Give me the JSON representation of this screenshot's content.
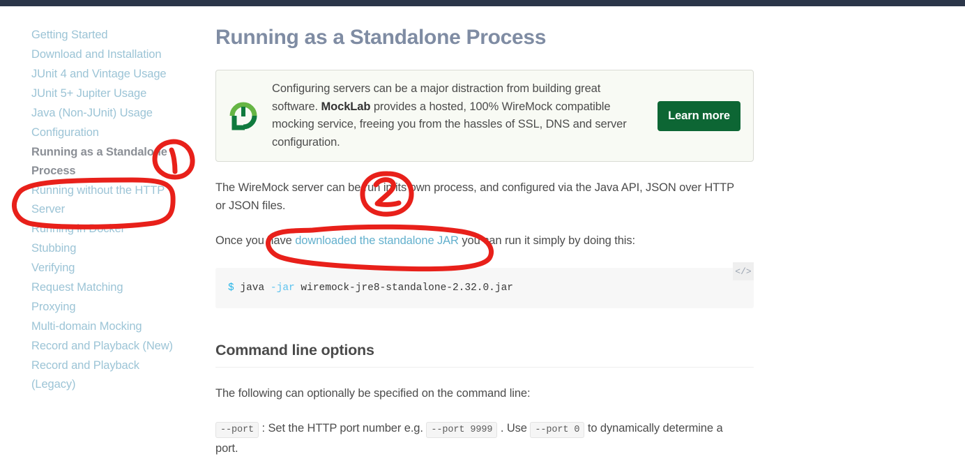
{
  "topbar": {
    "color": "#2b3649"
  },
  "sidebar": {
    "items": [
      {
        "label": "Getting Started",
        "active": false
      },
      {
        "label": "Download and Installation",
        "active": false
      },
      {
        "label": "JUnit 4 and Vintage Usage",
        "active": false
      },
      {
        "label": "JUnit 5+ Jupiter Usage",
        "active": false
      },
      {
        "label": "Java (Non-JUnit) Usage",
        "active": false
      },
      {
        "label": "Configuration",
        "active": false
      },
      {
        "label": "Running as a Standalone Process",
        "active": true
      },
      {
        "label": "Running without the HTTP Server",
        "active": false
      },
      {
        "label": "Running in Docker",
        "active": false
      },
      {
        "label": "Stubbing",
        "active": false
      },
      {
        "label": "Verifying",
        "active": false
      },
      {
        "label": "Request Matching",
        "active": false
      },
      {
        "label": "Proxying",
        "active": false
      },
      {
        "label": "Multi-domain Mocking",
        "active": false
      },
      {
        "label": "Record and Playback (New)",
        "active": false
      },
      {
        "label": "Record and Playback (Legacy)",
        "active": false
      }
    ],
    "link_color": "#9cc4d6",
    "active_color": "#8b8f96"
  },
  "main": {
    "title": "Running as a Standalone Process",
    "title_color": "#7f8ca3",
    "banner": {
      "logo_icon": "mocklab-logo-icon",
      "text_part1": "Configuring servers can be a major distraction from building great software. ",
      "brand": "MockLab",
      "text_part2": " provides a hosted, 100% WireMock compatible mocking service, freeing you from the hassles of SSL, DNS and server configuration.",
      "button_label": "Learn more",
      "button_color": "#0d6634",
      "background": "#f8faf4"
    },
    "paragraph1": "The WireMock server can be run in its own process, and configured via the Java API, JSON over HTTP or JSON files.",
    "paragraph2": {
      "before": "Once you have ",
      "link": "downloaded the standalone JAR",
      "after": " you can run it simply by doing this:"
    },
    "code_block": {
      "prompt": "$",
      "command": " java ",
      "flag": "-jar",
      "argument": " wiremock-jre8-standalone-2.32.0.jar",
      "copy_icon": "code-brackets-icon",
      "copy_icon_glyph": "</>"
    },
    "subtitle": "Command line options",
    "paragraph3": "The following can optionally be specified on the command line:",
    "option_line": {
      "chip1": "--port",
      "text1": " : Set the HTTP port number e.g. ",
      "chip2": "--port 9999",
      "text2": " . Use ",
      "chip3": "--port 0",
      "text3": " to dynamically determine a port."
    }
  },
  "annotations": {
    "color": "#e8201a",
    "marks": [
      {
        "name": "circled-number-1",
        "label": "1"
      },
      {
        "name": "circled-number-2",
        "label": "2"
      },
      {
        "name": "oval-sidebar-active",
        "label": ""
      },
      {
        "name": "oval-standalone-jar-link",
        "label": ""
      }
    ]
  }
}
